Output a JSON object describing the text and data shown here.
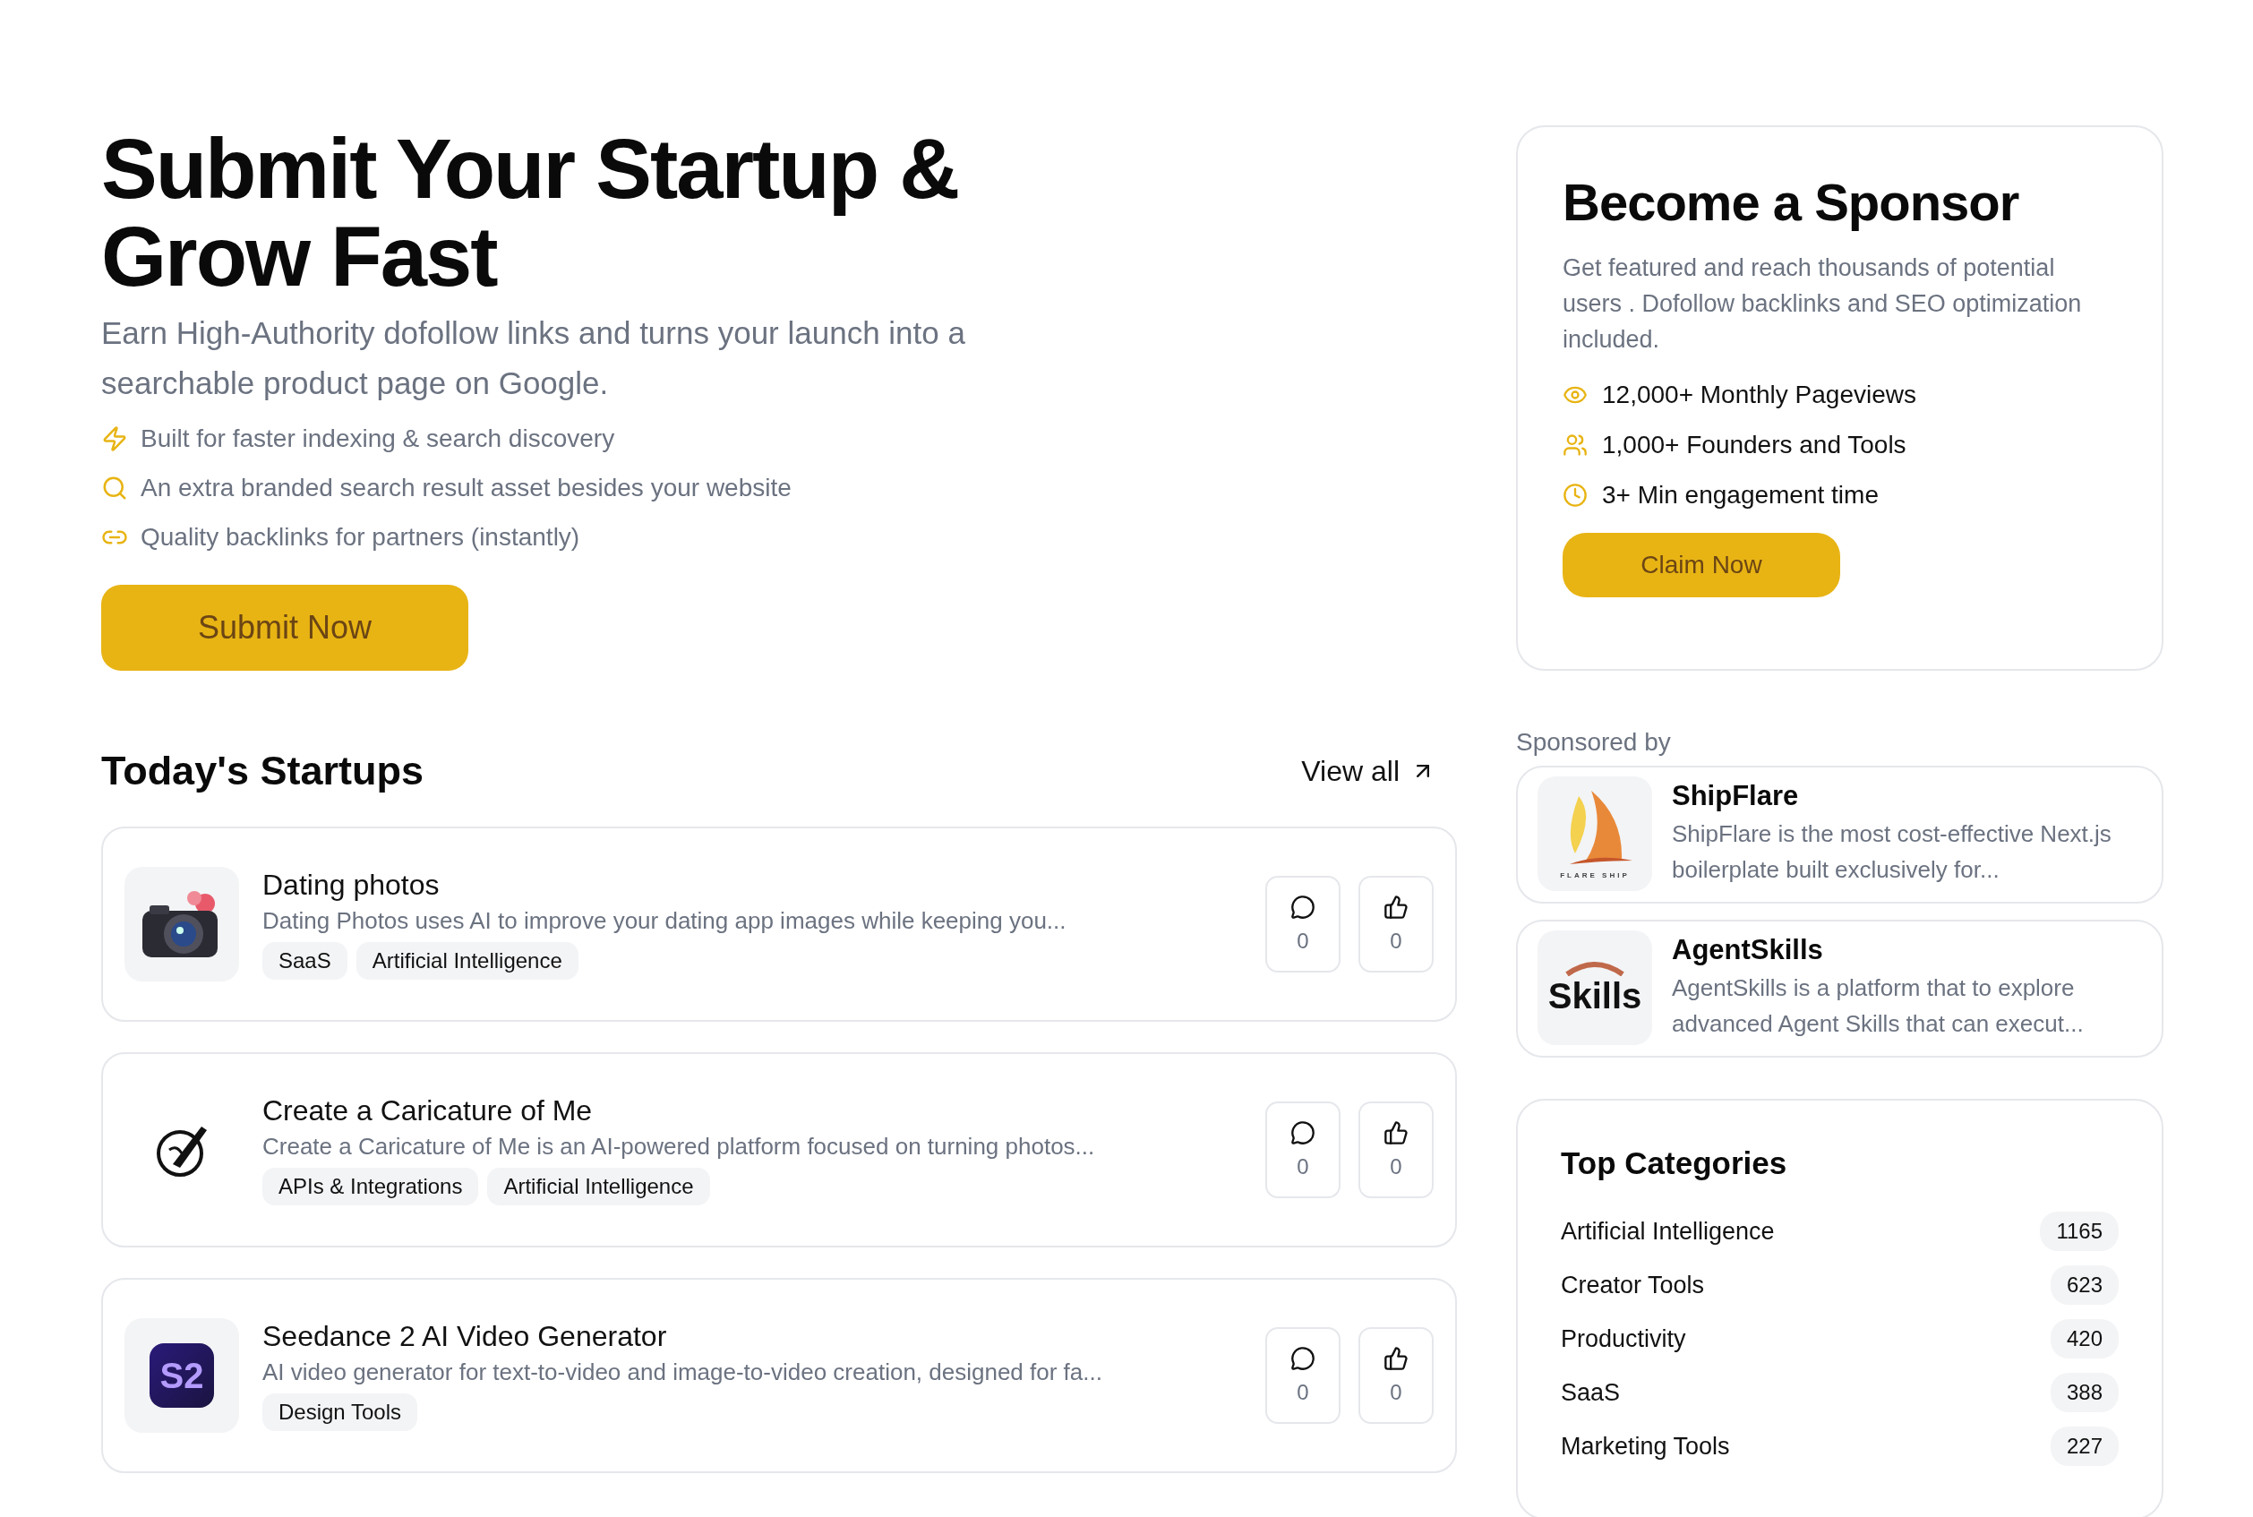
{
  "hero": {
    "title": "Submit Your Startup & Grow Fast",
    "subtitle": "Earn High-Authority dofollow links and turns your launch into a searchable product page on Google.",
    "features": [
      {
        "kind": "bolt",
        "text": "Built for faster indexing & search discovery"
      },
      {
        "kind": "search",
        "text": "An extra branded search result asset besides your website"
      },
      {
        "kind": "link",
        "text": "Quality backlinks for partners (instantly)"
      }
    ],
    "button": "Submit Now"
  },
  "sponsor_card": {
    "title": "Become a Sponsor",
    "description": "Get featured and reach thousands of potential users . Dofollow backlinks and SEO optimization included.",
    "stats": [
      {
        "kind": "eye",
        "text": "12,000+ Monthly Pageviews"
      },
      {
        "kind": "users",
        "text": "1,000+ Founders and Tools"
      },
      {
        "kind": "clock",
        "text": "3+ Min engagement time"
      }
    ],
    "button": "Claim Now"
  },
  "startups": {
    "title": "Today's Startups",
    "view_all": "View all",
    "items": [
      {
        "kind": "camera",
        "name": "Dating photos",
        "description": "Dating Photos uses AI to improve your dating app images while keeping you...",
        "tags": [
          "SaaS",
          "Artificial Intelligence"
        ],
        "comments": "0",
        "likes": "0"
      },
      {
        "kind": "pen",
        "name": "Create a Caricature of Me",
        "description": "Create a Caricature of Me is an AI-powered platform focused on turning photos...",
        "tags": [
          "APIs & Integrations",
          "Artificial Intelligence"
        ],
        "comments": "0",
        "likes": "0"
      },
      {
        "kind": "s2",
        "logo_text": "S2",
        "name": "Seedance 2 AI Video Generator",
        "description": "AI video generator for text-to-video and image-to-video creation, designed for fa...",
        "tags": [
          "Design Tools"
        ],
        "comments": "0",
        "likes": "0"
      }
    ]
  },
  "sponsored_by": {
    "label": "Sponsored by",
    "items": [
      {
        "kind": "sail",
        "logo_text": "FLARE SHIP",
        "name": "ShipFlare",
        "description": "ShipFlare is the most cost-effective Next.js boilerplate built exclusively for..."
      },
      {
        "kind": "skills",
        "logo_text": "Skills",
        "name": "AgentSkills",
        "description": "AgentSkills is a platform that to explore advanced Agent Skills that can execut..."
      }
    ]
  },
  "top_categories": {
    "title": "Top Categories",
    "items": [
      {
        "name": "Artificial Intelligence",
        "count": "1165"
      },
      {
        "name": "Creator Tools",
        "count": "623"
      },
      {
        "name": "Productivity",
        "count": "420"
      },
      {
        "name": "SaaS",
        "count": "388"
      },
      {
        "name": "Marketing Tools",
        "count": "227"
      }
    ]
  }
}
